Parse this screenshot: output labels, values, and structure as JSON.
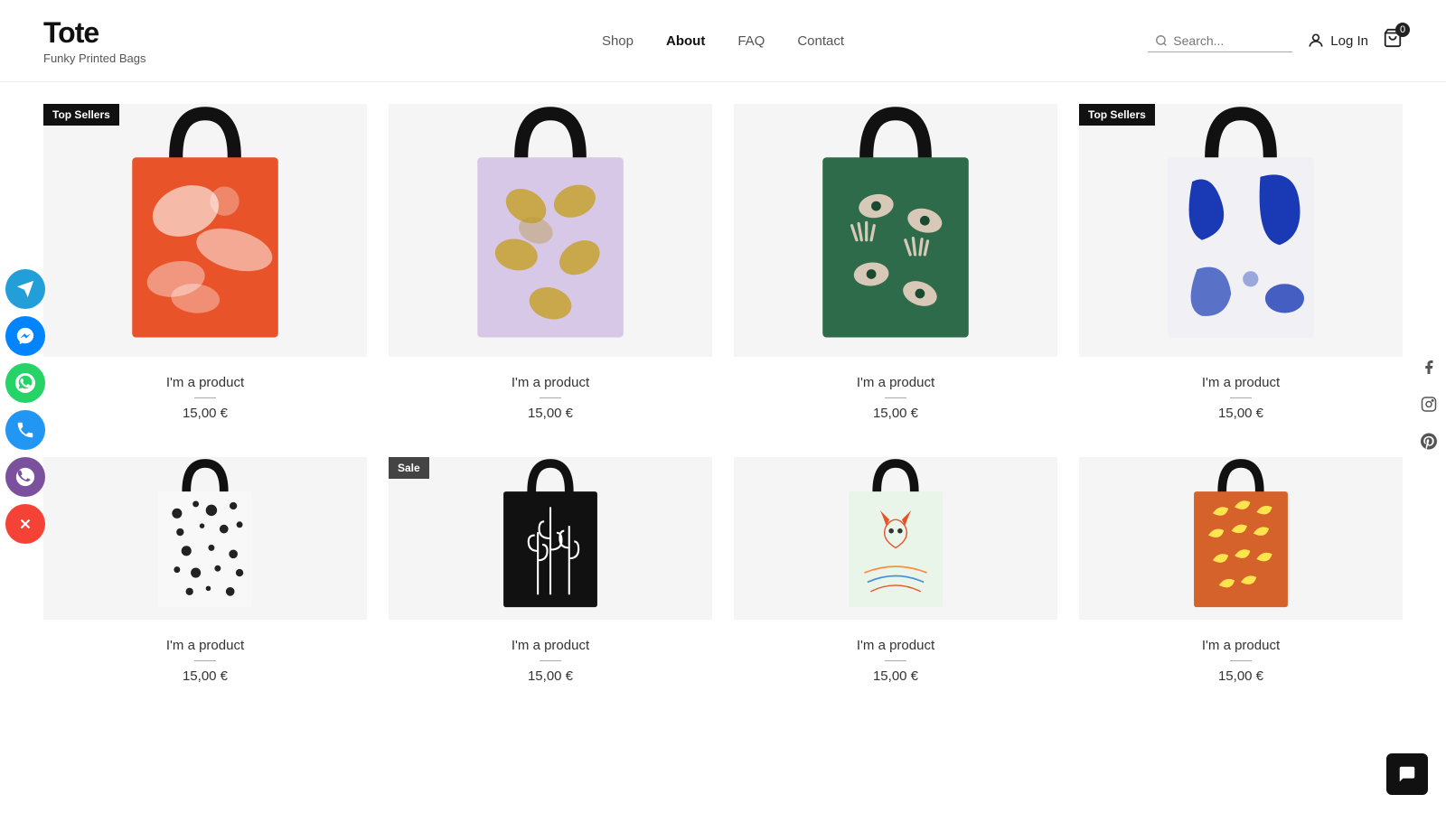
{
  "header": {
    "logo_title": "Tote",
    "logo_subtitle": "Funky Printed Bags",
    "nav_items": [
      {
        "label": "Shop",
        "active": false
      },
      {
        "label": "About",
        "active": true
      },
      {
        "label": "FAQ",
        "active": false
      },
      {
        "label": "Contact",
        "active": false
      }
    ],
    "search_placeholder": "Search...",
    "login_label": "Log In",
    "cart_count": "0"
  },
  "badges": {
    "top_sellers": "Top Sellers",
    "sale": "Sale"
  },
  "products": [
    {
      "id": 1,
      "name": "I'm a product",
      "price": "15,00 €",
      "badge": "Top Sellers",
      "bag_color": "orange"
    },
    {
      "id": 2,
      "name": "I'm a product",
      "price": "15,00 €",
      "badge": null,
      "bag_color": "lavender"
    },
    {
      "id": 3,
      "name": "I'm a product",
      "price": "15,00 €",
      "badge": null,
      "bag_color": "green"
    },
    {
      "id": 4,
      "name": "I'm a product",
      "price": "15,00 €",
      "badge": "Top Sellers",
      "bag_color": "blue_white"
    },
    {
      "id": 5,
      "name": "I'm a product",
      "price": "15,00 €",
      "badge": null,
      "bag_color": "dalmatian"
    },
    {
      "id": 6,
      "name": "I'm a product",
      "price": "15,00 €",
      "badge": "Sale",
      "bag_color": "cactus"
    },
    {
      "id": 7,
      "name": "I'm a product",
      "price": "15,00 €",
      "badge": null,
      "bag_color": "fox"
    },
    {
      "id": 8,
      "name": "I'm a product",
      "price": "15,00 €",
      "badge": null,
      "bag_color": "banana"
    }
  ],
  "social": {
    "telegram_label": "Telegram",
    "messenger_label": "Messenger",
    "whatsapp_label": "WhatsApp",
    "phone_label": "Phone",
    "viber_label": "Viber",
    "close_label": "Close",
    "facebook_label": "Facebook",
    "instagram_label": "Instagram",
    "pinterest_label": "Pinterest",
    "chat_label": "Chat"
  },
  "colors": {
    "primary": "#111111",
    "accent": "#E8532A",
    "background": "#ffffff"
  }
}
